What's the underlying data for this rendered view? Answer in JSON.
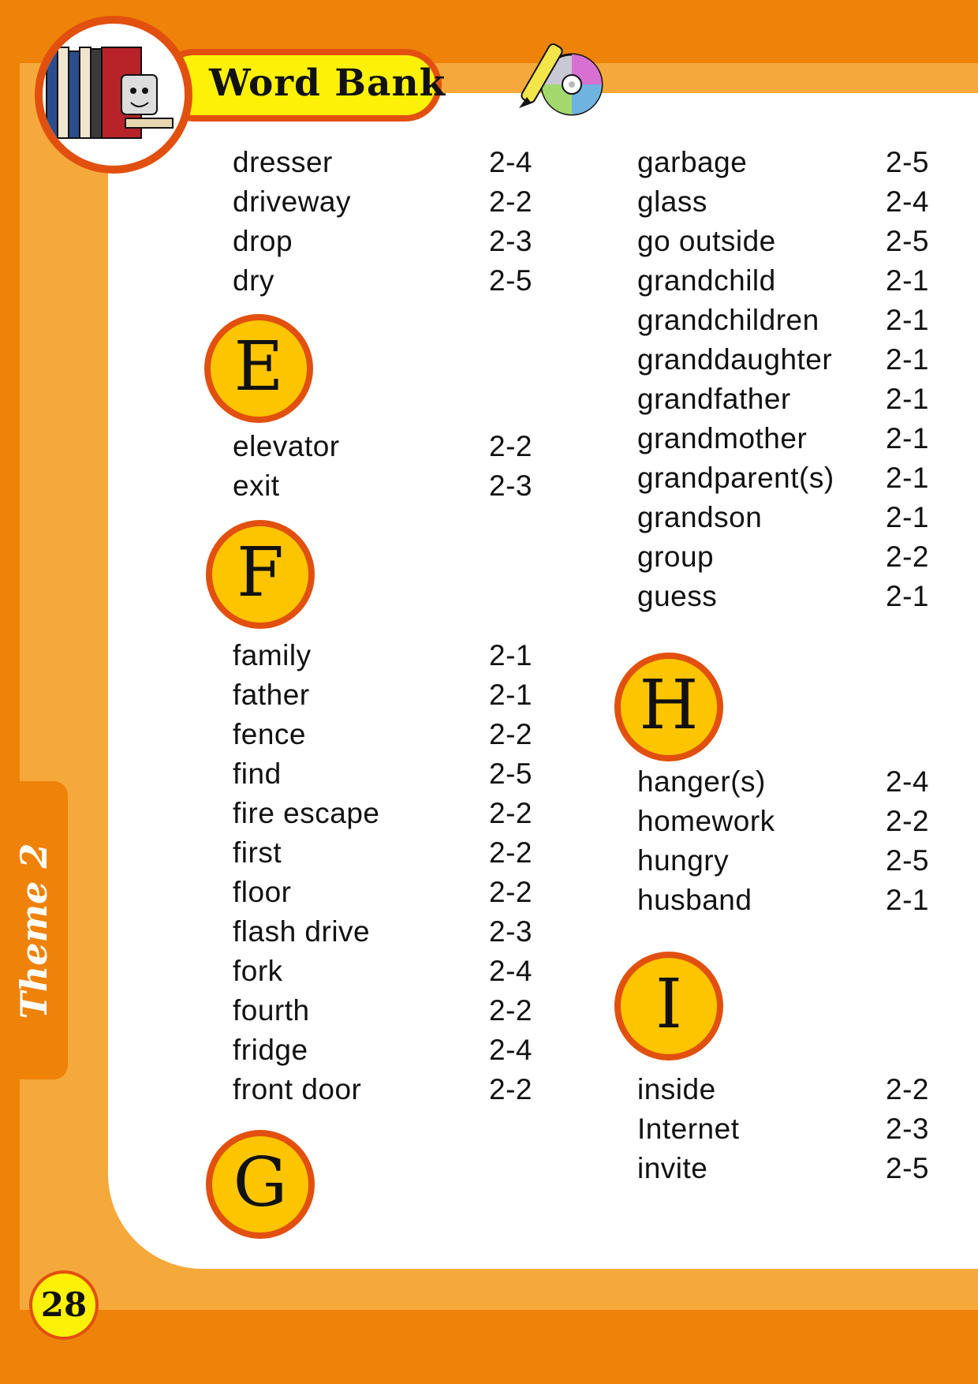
{
  "header": {
    "title": "Word Bank"
  },
  "side_tab": {
    "label": "Theme 2"
  },
  "page_number": "28",
  "colors": {
    "orange": "#ef8208",
    "light_orange": "#f6a93b",
    "yellow": "#fdf108",
    "letter_yellow": "#fdc500",
    "ring": "#e2500f"
  },
  "icons": {
    "logo": "books-computer-mascot-icon",
    "media": "pen-and-cd-icon"
  },
  "letters": {
    "E": "E",
    "F": "F",
    "G": "G",
    "H": "H",
    "I": "I"
  },
  "col1": {
    "d": [
      {
        "word": "dresser",
        "ref": "2-4"
      },
      {
        "word": "driveway",
        "ref": "2-2"
      },
      {
        "word": "drop",
        "ref": "2-3"
      },
      {
        "word": "dry",
        "ref": "2-5"
      }
    ],
    "e": [
      {
        "word": "elevator",
        "ref": "2-2"
      },
      {
        "word": "exit",
        "ref": "2-3"
      }
    ],
    "f": [
      {
        "word": "family",
        "ref": "2-1"
      },
      {
        "word": "father",
        "ref": "2-1"
      },
      {
        "word": "fence",
        "ref": "2-2"
      },
      {
        "word": "find",
        "ref": "2-5"
      },
      {
        "word": "fire escape",
        "ref": "2-2"
      },
      {
        "word": "first",
        "ref": "2-2"
      },
      {
        "word": "floor",
        "ref": "2-2"
      },
      {
        "word": "flash drive",
        "ref": "2-3"
      },
      {
        "word": "fork",
        "ref": "2-4"
      },
      {
        "word": "fourth",
        "ref": "2-2"
      },
      {
        "word": "fridge",
        "ref": "2-4"
      },
      {
        "word": "front door",
        "ref": "2-2"
      }
    ]
  },
  "col2": {
    "g": [
      {
        "word": "garbage",
        "ref": "2-5"
      },
      {
        "word": "glass",
        "ref": "2-4"
      },
      {
        "word": "go outside",
        "ref": "2-5"
      },
      {
        "word": "grandchild",
        "ref": "2-1"
      },
      {
        "word": "grandchildren",
        "ref": "2-1"
      },
      {
        "word": "granddaughter",
        "ref": "2-1"
      },
      {
        "word": "grandfather",
        "ref": "2-1"
      },
      {
        "word": "grandmother",
        "ref": "2-1"
      },
      {
        "word": "grandparent(s)",
        "ref": "2-1"
      },
      {
        "word": "grandson",
        "ref": "2-1"
      },
      {
        "word": "group",
        "ref": "2-2"
      },
      {
        "word": "guess",
        "ref": "2-1"
      }
    ],
    "h": [
      {
        "word": "hanger(s)",
        "ref": "2-4"
      },
      {
        "word": "homework",
        "ref": "2-2"
      },
      {
        "word": "hungry",
        "ref": "2-5"
      },
      {
        "word": "husband",
        "ref": "2-1"
      }
    ],
    "i": [
      {
        "word": "inside",
        "ref": "2-2"
      },
      {
        "word": "Internet",
        "ref": "2-3"
      },
      {
        "word": "invite",
        "ref": "2-5"
      }
    ]
  }
}
